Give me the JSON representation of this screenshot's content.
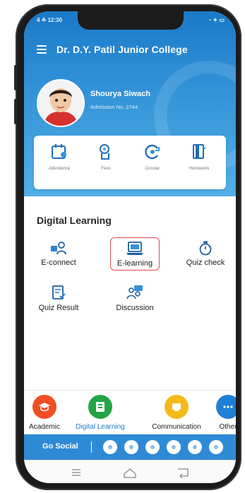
{
  "status_bar": {
    "left": "4 ≙ 12:30",
    "right": "◔ ✦ ▭"
  },
  "app": {
    "title": "Dr. D.Y. Patil Junior College"
  },
  "profile": {
    "name": "Shourya Siwach",
    "admission": "Admission No. 2744"
  },
  "quick_actions": [
    {
      "label": "Attendance",
      "icon": "calendar-user-icon"
    },
    {
      "label": "Fees",
      "icon": "fees-icon"
    },
    {
      "label": "Circular",
      "icon": "circular-icon"
    },
    {
      "label": "Homework",
      "icon": "homework-book-icon"
    }
  ],
  "digital_learning": {
    "title": "Digital Learning",
    "tiles": [
      {
        "label": "E-connect",
        "icon": "e-connect-icon"
      },
      {
        "label": "E-learning",
        "icon": "e-learning-laptop-icon"
      },
      {
        "label": "Quiz check",
        "icon": "stopwatch-icon"
      },
      {
        "label": "Quiz Result",
        "icon": "quiz-result-icon"
      },
      {
        "label": "Discussion",
        "icon": "discussion-icon"
      }
    ]
  },
  "categories": [
    {
      "label": "Academic",
      "icon": "academic-cap-icon",
      "color": "#f04e23"
    },
    {
      "label": "Digital Learning",
      "icon": "digital-learning-icon",
      "color": "#21a545"
    },
    {
      "label": "Communication",
      "icon": "communication-icon",
      "color": "#f6b91a"
    },
    {
      "label": "Other",
      "icon": "more-dots-icon",
      "color": "#1f7fd6"
    }
  ],
  "go_social": {
    "label": "Go Social",
    "icons": [
      "instagram-icon",
      "facebook-icon",
      "linkedin-icon",
      "youtube-icon",
      "twitter-icon",
      "link-icon"
    ]
  },
  "colors": {
    "primary": "#1a79c8",
    "highlight": "#e04a4a",
    "active_category": "#1d79c8"
  }
}
